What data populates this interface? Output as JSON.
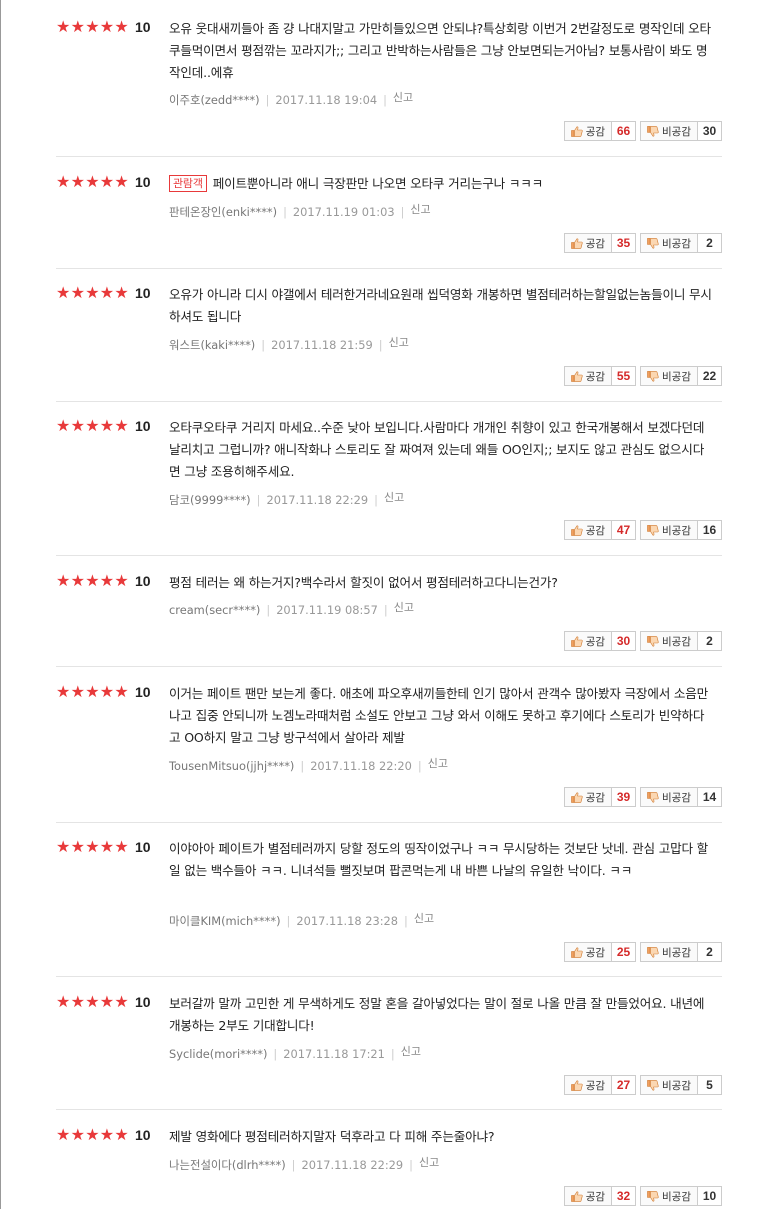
{
  "labels": {
    "like": "공감",
    "dislike": "비공감",
    "report": "신고",
    "badge": "관람객",
    "star": "★"
  },
  "colors": {
    "star": "#e8393a",
    "like_count": "#d52a2a"
  },
  "reviews": [
    {
      "score": "10",
      "badge": "",
      "text": "오유 웃대새끼들아 좀 걍 나대지말고 가만히들있으면 안되냐?특상회랑 이번거 2번갈정도로 명작인데 오타쿠들먹이면서 평점깎는 꼬라지가;; 그리고 반박하는사람들은 그냥 안보면되는거아님? 보통사람이 봐도 명작인데..에휴",
      "author": "이주호(zedd****)",
      "date": "2017.11.18 19:04",
      "likes": "66",
      "dislikes": "30"
    },
    {
      "score": "10",
      "badge": "관람객",
      "text": "페이트뿐아니라 애니 극장판만 나오면 오타쿠 거리는구나 ㅋㅋㅋ",
      "author": "판테온장인(enki****)",
      "date": "2017.11.19 01:03",
      "likes": "35",
      "dislikes": "2"
    },
    {
      "score": "10",
      "badge": "",
      "text": "오유가 아니라 디시 야갤에서 테러한거라네요원래 씹덕영화 개봉하면 별점테러하는할일없는놈들이니 무시하셔도 됩니다",
      "author": "워스트(kaki****)",
      "date": "2017.11.18 21:59",
      "likes": "55",
      "dislikes": "22"
    },
    {
      "score": "10",
      "badge": "",
      "text": "오타쿠오타쿠 거리지 마세요..수준 낮아 보입니다.사람마다 개개인 취향이 있고 한국개봉해서 보겠다던데 날리치고 그럽니까? 애니작화나 스토리도 잘 짜여져 있는데 왜들 OO인지;; 보지도 않고 관심도 없으시다면 그냥 조용히해주세요.",
      "author": "담코(9999****)",
      "date": "2017.11.18 22:29",
      "likes": "47",
      "dislikes": "16"
    },
    {
      "score": "10",
      "badge": "",
      "text": "평점 테러는 왜 하는거지?백수라서 할짓이 없어서 평점테러하고다니는건가?",
      "author": "cream(secr****)",
      "date": "2017.11.19 08:57",
      "likes": "30",
      "dislikes": "2"
    },
    {
      "score": "10",
      "badge": "",
      "text": "이거는 페이트 팬만 보는게 좋다. 애초에 파오후새끼들한테 인기 많아서 관객수 많아봤자 극장에서 소음만 나고 집중 안되니까 노겜노라때처럼 소설도 안보고 그냥 와서 이해도 못하고 후기에다 스토리가 빈약하다고 OO하지 말고 그냥 방구석에서 살아라 제발",
      "author": "TousenMitsuo(jjhj****)",
      "date": "2017.11.18 22:20",
      "likes": "39",
      "dislikes": "14"
    },
    {
      "score": "10",
      "badge": "",
      "text": "이야아아 페이트가 별점테러까지 당할 정도의 띵작이었구나 ㅋㅋ 무시당하는 것보단 낫네. 관심 고맙다 할 일 없는 백수들아 ㅋㅋ. 니녀석들 뻘짓보며 팝콘먹는게 내 바쁜 나날의 유일한 낙이다. ㅋㅋ",
      "author": "마이클KIM(mich****)",
      "date": "2017.11.18 23:28",
      "likes": "25",
      "dislikes": "2"
    },
    {
      "score": "10",
      "badge": "",
      "text": "보러갈까 말까 고민한 게 무색하게도 정말 혼을 갈아넣었다는 말이 절로 나올 만큼 잘 만들었어요. 내년에 개봉하는 2부도 기대합니다!",
      "author": "Syclide(mori****)",
      "date": "2017.11.18 17:21",
      "likes": "27",
      "dislikes": "5"
    },
    {
      "score": "10",
      "badge": "",
      "text": "제발 영화에다 평점테러하지말자 덕후라고 다 피해 주는줄아냐?",
      "author": "나는전설이다(dlrh****)",
      "date": "2017.11.18 22:29",
      "likes": "32",
      "dislikes": "10"
    }
  ]
}
